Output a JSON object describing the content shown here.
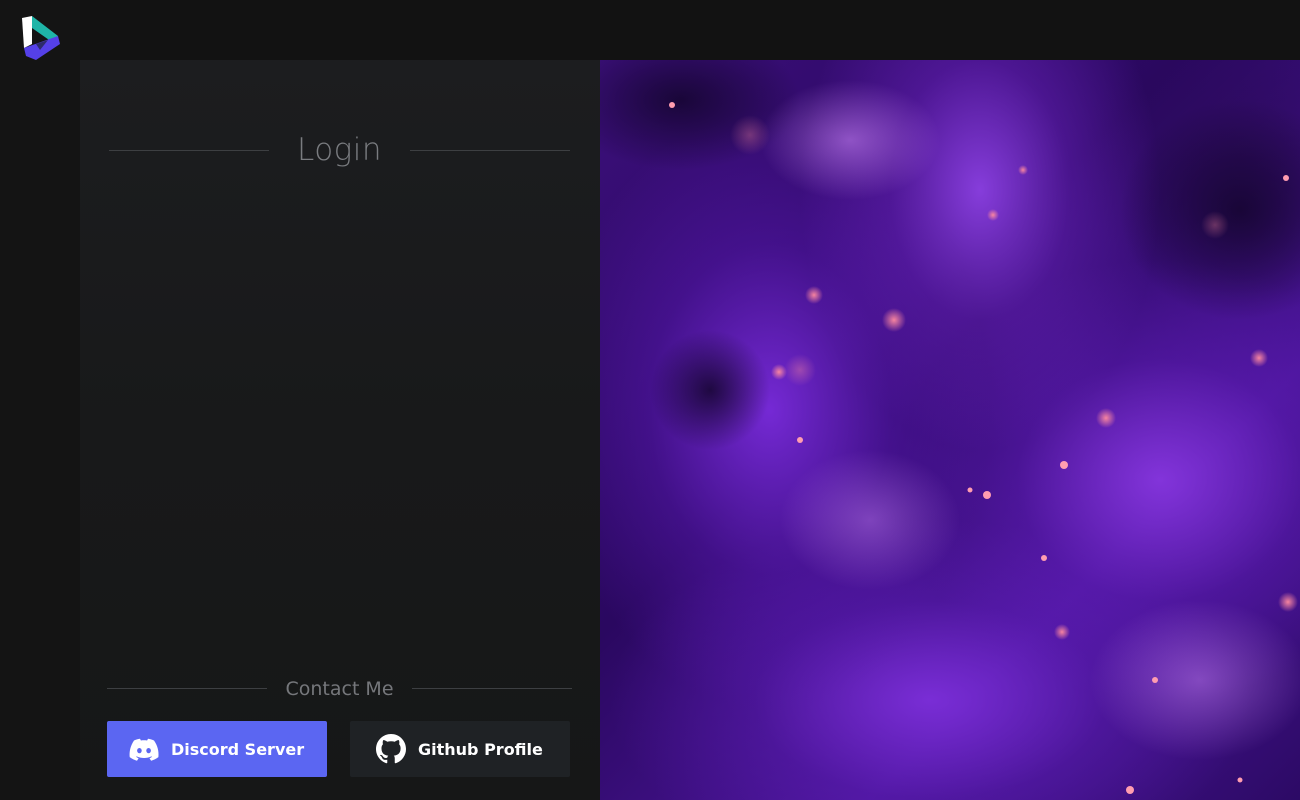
{
  "login": {
    "title": "Login"
  },
  "contact": {
    "heading": "Contact Me",
    "discord_label": "Discord Server",
    "github_label": "Github Profile"
  },
  "colors": {
    "discord_button": "#5b66f2",
    "github_button": "#1f2225",
    "background": "#121212",
    "hero_accent": "#7b2de0"
  },
  "icons": {
    "logo": "app-logo",
    "discord": "discord-icon",
    "github": "github-icon"
  }
}
